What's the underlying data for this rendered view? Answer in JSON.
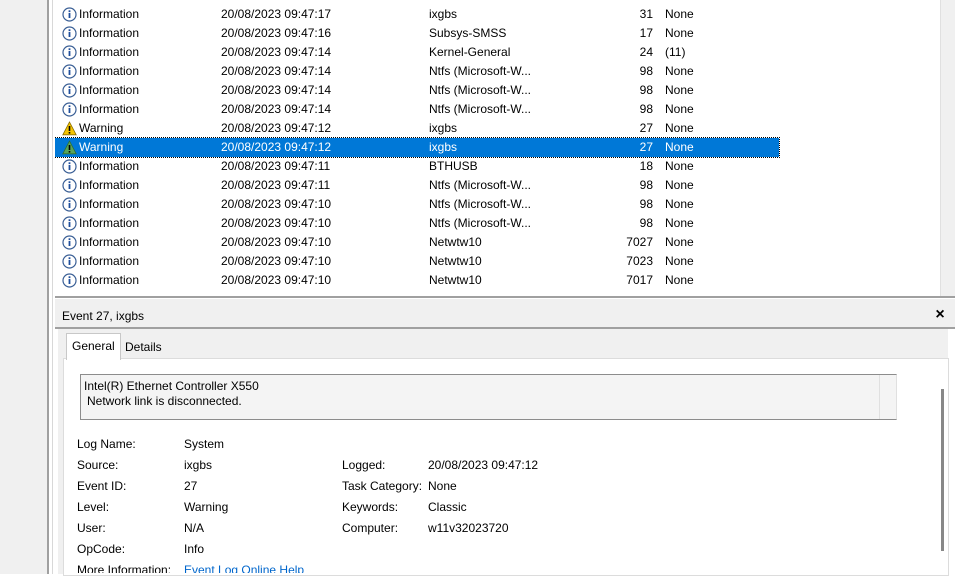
{
  "events": [
    {
      "level": "Information",
      "datetime": "20/08/2023 09:47:17",
      "source": "ixgbs",
      "event_id": "31",
      "task": "None",
      "icon": "info-icon",
      "selected": false
    },
    {
      "level": "Information",
      "datetime": "20/08/2023 09:47:16",
      "source": "Subsys-SMSS",
      "event_id": "17",
      "task": "None",
      "icon": "info-icon",
      "selected": false
    },
    {
      "level": "Information",
      "datetime": "20/08/2023 09:47:14",
      "source": "Kernel-General",
      "event_id": "24",
      "task": "(11)",
      "icon": "info-icon",
      "selected": false
    },
    {
      "level": "Information",
      "datetime": "20/08/2023 09:47:14",
      "source": "Ntfs (Microsoft-W...",
      "event_id": "98",
      "task": "None",
      "icon": "info-icon",
      "selected": false
    },
    {
      "level": "Information",
      "datetime": "20/08/2023 09:47:14",
      "source": "Ntfs (Microsoft-W...",
      "event_id": "98",
      "task": "None",
      "icon": "info-icon",
      "selected": false
    },
    {
      "level": "Information",
      "datetime": "20/08/2023 09:47:14",
      "source": "Ntfs (Microsoft-W...",
      "event_id": "98",
      "task": "None",
      "icon": "info-icon",
      "selected": false
    },
    {
      "level": "Warning",
      "datetime": "20/08/2023 09:47:12",
      "source": "ixgbs",
      "event_id": "27",
      "task": "None",
      "icon": "warning-icon",
      "selected": false
    },
    {
      "level": "Warning",
      "datetime": "20/08/2023 09:47:12",
      "source": "ixgbs",
      "event_id": "27",
      "task": "None",
      "icon": "warning-icon",
      "selected": true
    },
    {
      "level": "Information",
      "datetime": "20/08/2023 09:47:11",
      "source": "BTHUSB",
      "event_id": "18",
      "task": "None",
      "icon": "info-icon",
      "selected": false
    },
    {
      "level": "Information",
      "datetime": "20/08/2023 09:47:11",
      "source": "Ntfs (Microsoft-W...",
      "event_id": "98",
      "task": "None",
      "icon": "info-icon",
      "selected": false
    },
    {
      "level": "Information",
      "datetime": "20/08/2023 09:47:10",
      "source": "Ntfs (Microsoft-W...",
      "event_id": "98",
      "task": "None",
      "icon": "info-icon",
      "selected": false
    },
    {
      "level": "Information",
      "datetime": "20/08/2023 09:47:10",
      "source": "Ntfs (Microsoft-W...",
      "event_id": "98",
      "task": "None",
      "icon": "info-icon",
      "selected": false
    },
    {
      "level": "Information",
      "datetime": "20/08/2023 09:47:10",
      "source": "Netwtw10",
      "event_id": "7027",
      "task": "None",
      "icon": "info-icon",
      "selected": false
    },
    {
      "level": "Information",
      "datetime": "20/08/2023 09:47:10",
      "source": "Netwtw10",
      "event_id": "7023",
      "task": "None",
      "icon": "info-icon",
      "selected": false
    },
    {
      "level": "Information",
      "datetime": "20/08/2023 09:47:10",
      "source": "Netwtw10",
      "event_id": "7017",
      "task": "None",
      "icon": "info-icon",
      "selected": false
    }
  ],
  "details": {
    "title": "Event 27, ixgbs",
    "close_label": "×",
    "tabs": {
      "general": "General",
      "details": "Details"
    },
    "message_line1": "Intel(R) Ethernet Controller X550",
    "message_line2": "Network link is disconnected.",
    "labels": {
      "log_name": "Log Name:",
      "source": "Source:",
      "event_id": "Event ID:",
      "level": "Level:",
      "user": "User:",
      "opcode": "OpCode:",
      "more_info": "More Information:",
      "logged": "Logged:",
      "task_category": "Task Category:",
      "keywords": "Keywords:",
      "computer": "Computer:"
    },
    "values": {
      "log_name": "System",
      "source": "ixgbs",
      "event_id": "27",
      "level": "Warning",
      "user": "N/A",
      "opcode": "Info",
      "more_info_link": "Event Log Online Help",
      "logged": "20/08/2023 09:47:12",
      "task_category": "None",
      "keywords": "Classic",
      "computer": "w11v32023720"
    }
  },
  "colors": {
    "selection": "#0078d7",
    "link": "#0066cc",
    "warning": "#f5c400",
    "info": "#1f4e9c"
  }
}
